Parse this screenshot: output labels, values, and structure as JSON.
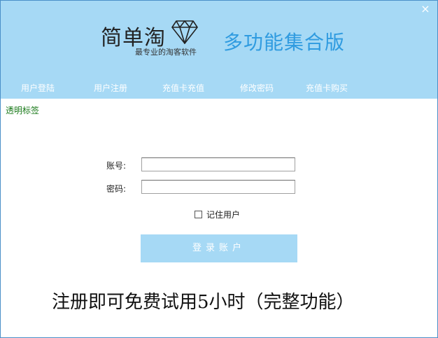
{
  "header": {
    "close_icon": "×",
    "logo_title": "简单淘",
    "logo_subtitle": "最专业的淘客软件",
    "edition": "多功能集合版",
    "diamond_icon": "diamond-icon"
  },
  "nav": {
    "items": [
      {
        "label": "用户登陆"
      },
      {
        "label": "用户注册"
      },
      {
        "label": "充值卡充值"
      },
      {
        "label": "修改密码"
      },
      {
        "label": "充值卡购买"
      }
    ]
  },
  "tag_label": "透明标签",
  "form": {
    "account_label": "账号:",
    "account_value": "",
    "password_label": "密码:",
    "password_value": "",
    "remember_label": "记住用户",
    "remember_checked": false,
    "login_label": "登录账户"
  },
  "promo": "注册即可免费试用5小时（完整功能）",
  "colors": {
    "header_bg": "#a6d9f5",
    "edition_text": "#2f9be0",
    "tag_text": "#1a7a1a"
  }
}
